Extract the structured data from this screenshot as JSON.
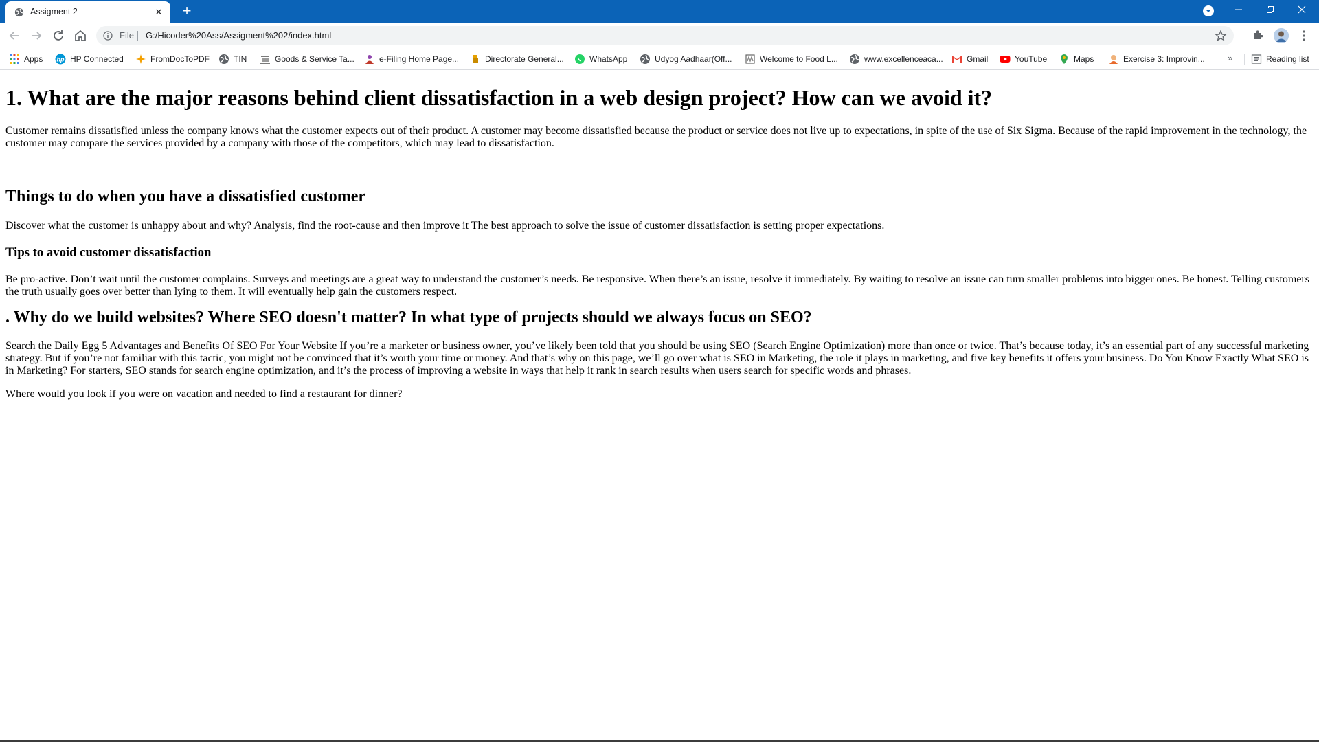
{
  "browser": {
    "tab_title": "Assigment 2",
    "new_tab_symbol": "+",
    "scheme_label": "File",
    "url": "G:/Hicoder%20Ass/Assigment%202/index.html",
    "bookmarks": [
      {
        "label": "Apps",
        "icon": "apps-grid-icon",
        "color": "#ea4335"
      },
      {
        "label": "HP Connected",
        "icon": "hp-logo-icon",
        "color": "#0096d6"
      },
      {
        "label": "FromDocToPDF",
        "icon": "fromdoctopdf-icon",
        "color": "#f4a000"
      },
      {
        "label": "TIN",
        "icon": "globe-icon",
        "color": "#5f6368"
      },
      {
        "label": "Goods & Service Ta...",
        "icon": "gst-emblem-icon",
        "color": "#7a7a7a"
      },
      {
        "label": "e-Filing Home Page...",
        "icon": "efiling-icon",
        "color": "#8e44ad"
      },
      {
        "label": "Directorate General...",
        "icon": "directorate-icon",
        "color": "#e6a100"
      },
      {
        "label": "WhatsApp",
        "icon": "whatsapp-icon",
        "color": "#25d366"
      },
      {
        "label": "Udyog Aadhaar(Off...",
        "icon": "globe-icon",
        "color": "#5f6368"
      },
      {
        "label": "Welcome to Food L...",
        "icon": "food-license-icon",
        "color": "#666666"
      },
      {
        "label": "www.excellenceaca...",
        "icon": "globe-icon",
        "color": "#5f6368"
      },
      {
        "label": "Gmail",
        "icon": "gmail-icon",
        "color": "#ea4335"
      },
      {
        "label": "YouTube",
        "icon": "youtube-icon",
        "color": "#ff0000"
      },
      {
        "label": "Maps",
        "icon": "maps-pin-icon",
        "color": "#34a853"
      },
      {
        "label": "Exercise 3: Improvin...",
        "icon": "exercise-icon",
        "color": "#e86a2c"
      }
    ],
    "more_bookmarks": "»",
    "reading_list": "Reading list",
    "colors": {
      "titlebar": "#0b63b7",
      "omnibox": "#f1f3f4"
    }
  },
  "page": {
    "h1": "1. What are the major reasons behind client dissatisfaction in a web design project? How can we avoid it?",
    "p1": "Customer remains dissatisfied unless the company knows what the customer expects out of their product. A customer may become dissatisfied because the product or service does not live up to expectations, in spite of the use of Six Sigma. Because of the rapid improvement in the technology, the customer may compare the services provided by a company with those of the competitors, which may lead to dissatisfaction.",
    "h2a": "Things to do when you have a dissatisfied customer",
    "p2": "Discover what the customer is unhappy about and why? Analysis, find the root-cause and then improve it The best approach to solve the issue of customer dissatisfaction is setting proper expectations.",
    "h3": "Tips to avoid customer dissatisfaction",
    "p3": "Be pro-active. Don’t wait until the customer complains. Surveys and meetings are a great way to understand the customer’s needs. Be responsive. When there’s an issue, resolve it immediately. By waiting to resolve an issue can turn smaller problems into bigger ones. Be honest. Telling customers the truth usually goes over better than lying to them. It will eventually help gain the customers respect.",
    "h2b": ". Why do we build websites? Where SEO doesn't matter? In what type of projects should we always focus on SEO?",
    "p4": "Search the Daily Egg 5 Advantages and Benefits Of SEO For Your Website If you’re a marketer or business owner, you’ve likely been told that you should be using SEO (Search Engine Optimization) more than once or twice. That’s because today, it’s an essential part of any successful marketing strategy. But if you’re not familiar with this tactic, you might not be convinced that it’s worth your time or money. And that’s why on this page, we’ll go over what is SEO in Marketing, the role it plays in marketing, and five key benefits it offers your business. Do You Know Exactly What SEO is in Marketing? For starters, SEO stands for search engine optimization, and it’s the process of improving a website in ways that help it rank in search results when users search for specific words and phrases.",
    "p5": "Where would you look if you were on vacation and needed to find a restaurant for dinner?"
  }
}
